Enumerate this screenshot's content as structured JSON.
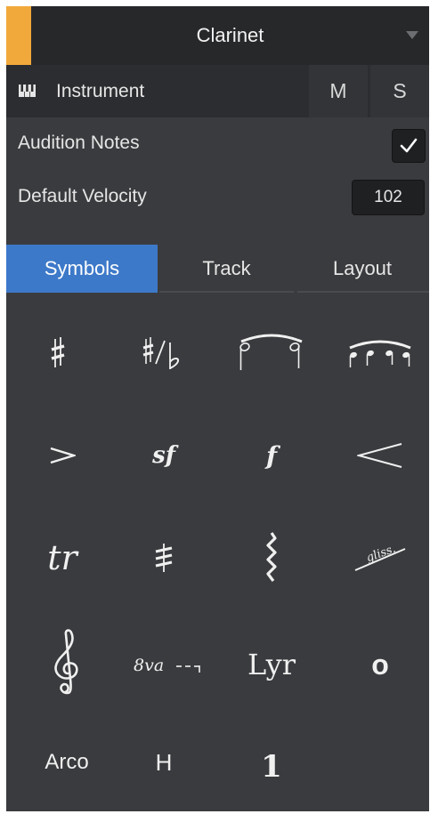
{
  "header": {
    "title": "Clarinet"
  },
  "instrument_row": {
    "label": "Instrument",
    "mute_label": "M",
    "solo_label": "S"
  },
  "settings": {
    "audition_label": "Audition Notes",
    "audition_checked": true,
    "velocity_label": "Default Velocity",
    "velocity_value": "102"
  },
  "tabs": [
    {
      "label": "Symbols",
      "active": true
    },
    {
      "label": "Track",
      "active": false
    },
    {
      "label": "Layout",
      "active": false
    }
  ],
  "symbols": {
    "sf": "sf",
    "forte": "f",
    "trill": "tr",
    "gliss": "gliss.",
    "octava": "8va",
    "lyrics": "Lyr",
    "harmonic": "o",
    "arco": "Arco",
    "hammer": "H",
    "fingering": "1"
  },
  "colors": {
    "accent": "#f2a93b",
    "tab_active": "#3d79c9",
    "panel_bg": "#3a3b3e",
    "header_bg": "#27282a"
  }
}
